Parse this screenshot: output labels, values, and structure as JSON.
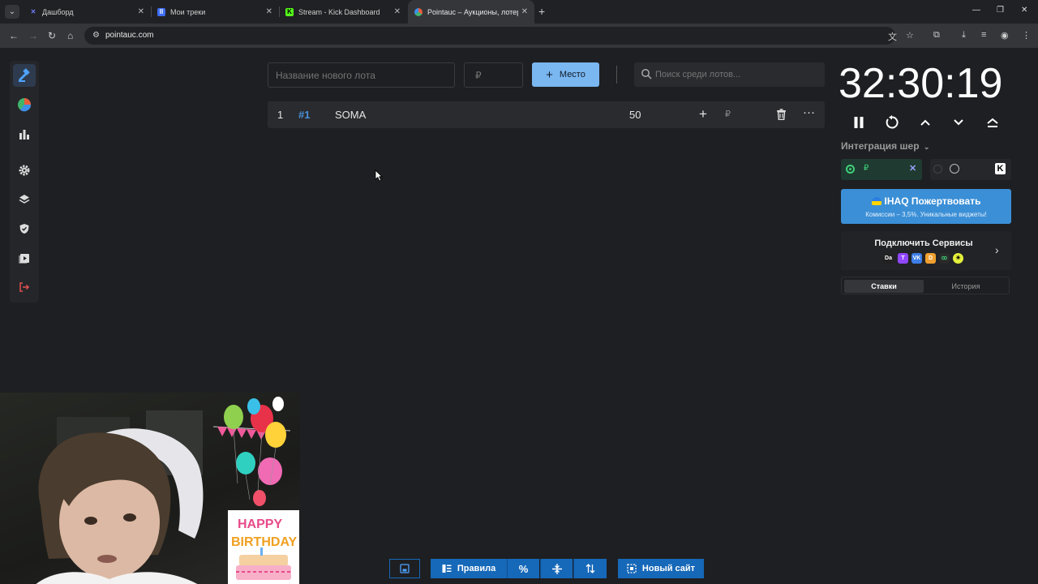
{
  "browser": {
    "tabs": [
      {
        "title": "Дашборд",
        "favicon": "kick-x-icon"
      },
      {
        "title": "Мои треки",
        "favicon": "tracks-icon"
      },
      {
        "title": "Stream - Kick Dashboard",
        "favicon": "kick-icon"
      },
      {
        "title": "Pointauc – Аукционы, лотере",
        "favicon": "pointauc-icon"
      }
    ],
    "active_tab_index": 3,
    "url": "pointauc.com"
  },
  "lot_form": {
    "name_placeholder": "Название нового лота",
    "amount_placeholder": "₽",
    "add_label": "Место",
    "search_placeholder": "Поиск среди лотов..."
  },
  "lots": [
    {
      "rank": "1",
      "id": "#1",
      "name": "SOMA",
      "amount": "50",
      "currency": "₽"
    }
  ],
  "timer": {
    "display": "32:30:19"
  },
  "integration": {
    "label": "Интеграция шер",
    "currency_symbol": "₽"
  },
  "donate": {
    "title": "IHAQ Пожертвовать",
    "subtitle": "Комиссии – 3,5%. Уникальные виджеты!"
  },
  "services": {
    "title": "Подключить Сервисы"
  },
  "history_tabs": {
    "bids": "Ставки",
    "history": "История"
  },
  "bottom_toolbar": {
    "rules": "Правила",
    "percent": "%",
    "new_site": "Новый сайт"
  },
  "colors": {
    "accent": "#7ab6f0",
    "primary": "#1668b8",
    "donate": "#3b8fd6",
    "background": "#1e1f22"
  }
}
